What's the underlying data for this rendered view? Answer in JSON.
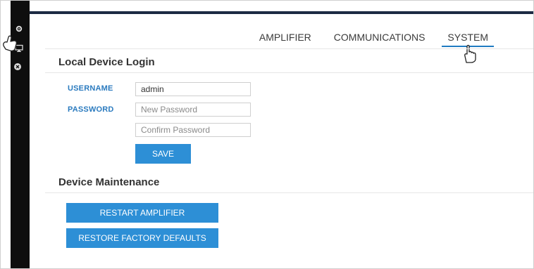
{
  "nav": {
    "tabs": [
      {
        "label": "AMPLIFIER",
        "active": false
      },
      {
        "label": "COMMUNICATIONS",
        "active": false
      },
      {
        "label": "SYSTEM",
        "active": true
      }
    ]
  },
  "login": {
    "title": "Local Device Login",
    "username_label": "USERNAME",
    "username_value": "admin",
    "password_label": "PASSWORD",
    "new_password_placeholder": "New Password",
    "confirm_password_placeholder": "Confirm Password",
    "save_label": "SAVE"
  },
  "maintenance": {
    "title": "Device Maintenance",
    "restart_label": "RESTART AMPLIFIER",
    "restore_label": "RESTORE FACTORY DEFAULTS"
  },
  "sidebar": {
    "icons": [
      "settings-icon",
      "monitor-icon",
      "close-circle-icon"
    ]
  },
  "colors": {
    "accent": "#2d8fd6",
    "label_blue": "#2b7bbf",
    "sidebar": "#0e0e0e",
    "topbar": "#1d2b44"
  }
}
